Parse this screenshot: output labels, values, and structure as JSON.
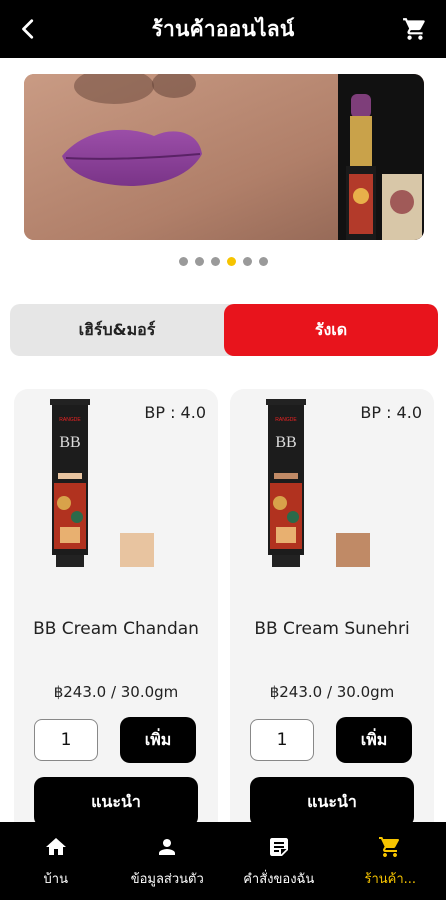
{
  "header": {
    "title": "ร้านค้าออนไลน์",
    "back_icon": "arrow-left-icon",
    "cart_icon": "cart-icon"
  },
  "banner": {
    "slide_count": 6,
    "active_slide": 4
  },
  "tabs": [
    {
      "label": "เฮิร์บ&มอร์",
      "active": false
    },
    {
      "label": "รังเด",
      "active": true
    }
  ],
  "products": [
    {
      "bp": "BP : 4.0",
      "name": "BB Cream Chandan",
      "price": "฿243.0 / 30.0gm",
      "quantity": "1",
      "add_label": "เพิ่ม",
      "recommend_label": "แนะนำ",
      "swatch_color": "#e8c4a0"
    },
    {
      "bp": "BP : 4.0",
      "name": "BB Cream Sunehri",
      "price": "฿243.0 / 30.0gm",
      "quantity": "1",
      "add_label": "เพิ่ม",
      "recommend_label": "แนะนำ",
      "swatch_color": "#c08a66"
    }
  ],
  "bottom_nav": [
    {
      "label": "บ้าน",
      "icon": "home-icon",
      "active": false
    },
    {
      "label": "ข้อมูลส่วนตัว",
      "icon": "person-icon",
      "active": false
    },
    {
      "label": "คำสั่งของฉัน",
      "icon": "orders-icon",
      "active": false
    },
    {
      "label": "ร้านค้า...",
      "icon": "cart-icon",
      "active": true
    }
  ],
  "colors": {
    "accent_red": "#e8141c",
    "active_yellow": "#f6c400",
    "bar_black": "#000000"
  }
}
